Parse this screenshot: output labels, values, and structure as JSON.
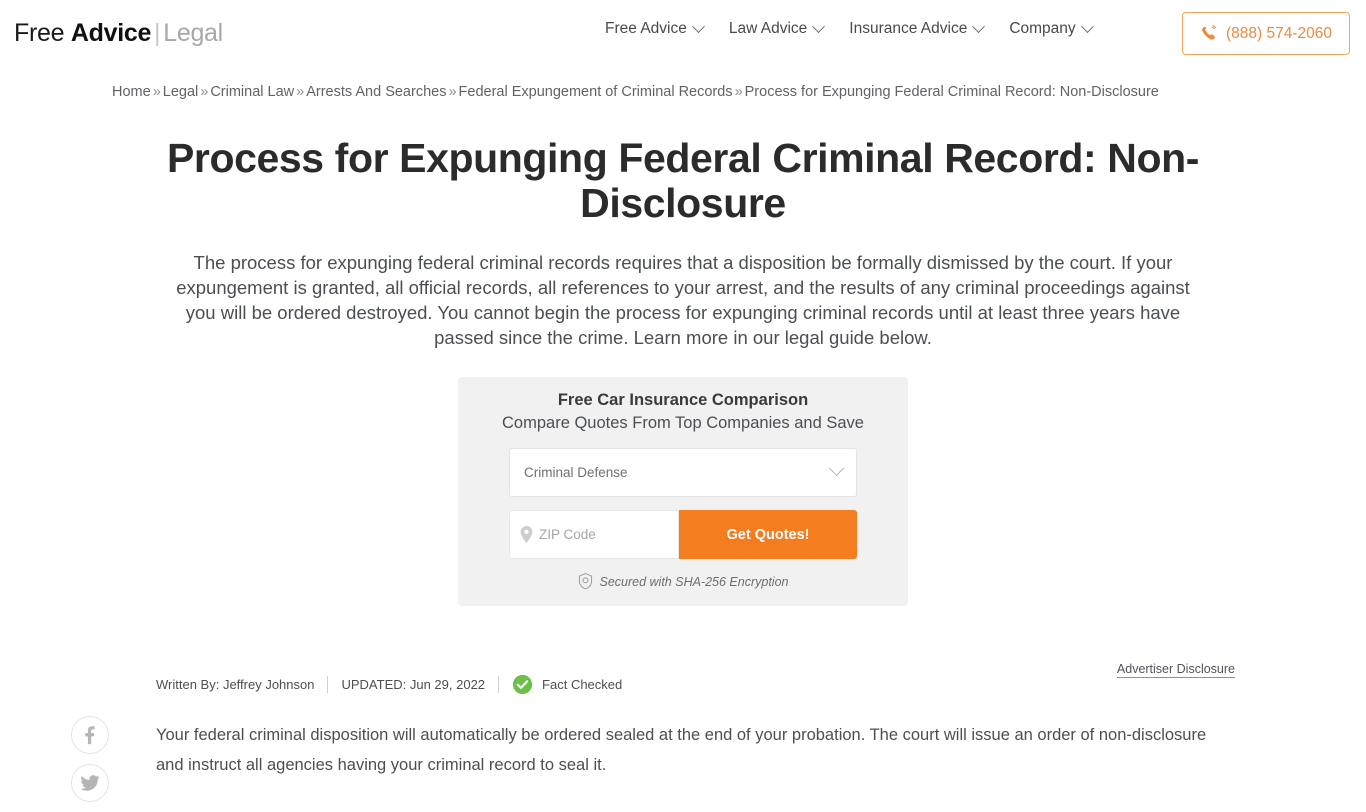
{
  "header": {
    "logo": {
      "part1": "Free ",
      "part2": "Advice",
      "divider": "|",
      "part3": "Legal"
    },
    "nav": [
      {
        "label": "Free Advice",
        "icon": "chevron-down-icon"
      },
      {
        "label": "Law Advice",
        "icon": "chevron-down-icon"
      },
      {
        "label": "Insurance Advice",
        "icon": "chevron-down-icon"
      },
      {
        "label": "Company",
        "icon": "chevron-down-icon"
      }
    ],
    "phone": {
      "number": "(888) 574-2060",
      "icon": "phone-icon",
      "color": "#e98b3e",
      "border_color": "#f0a35e"
    }
  },
  "breadcrumb": {
    "separator": "»",
    "items": [
      "Home",
      "Legal",
      "Criminal Law",
      "Arrests And Searches",
      "Federal Expungement of Criminal Records"
    ],
    "current": "Process for Expunging Federal Criminal Record: Non-Disclosure"
  },
  "article": {
    "title": "Process for Expunging Federal Criminal Record: Non-Disclosure",
    "lede": "The process for expunging federal criminal records requires that a disposition be formally dismissed by the court. If your expungement is granted, all official records, all references to your arrest, and the results of any criminal proceedings against you will be ordered destroyed. You cannot begin the process for expunging criminal records until at least three years have passed since the crime. Learn more in our legal guide below.",
    "body": "Your federal criminal disposition will automatically be ordered sealed at the end of your probation. The court will issue an order of non-disclosure and instruct all agencies having your criminal record to seal it."
  },
  "quote_form": {
    "title": "Free Car Insurance Comparison",
    "subtitle": "Compare Quotes From Top Companies and Save",
    "select": {
      "value": "Criminal Defense",
      "icon": "chevron-down-icon"
    },
    "zip": {
      "placeholder": "ZIP Code",
      "value": "",
      "icon": "map-pin-icon"
    },
    "submit_label": "Get Quotes!",
    "submit_color": "#f47d20",
    "secure_note": "Secured with SHA-256 Encryption",
    "secure_icon": "shield-check-icon",
    "background": "#f1f1f1"
  },
  "meta": {
    "advertiser_disclosure": "Advertiser Disclosure",
    "written_by": "Written By: Jeffrey Johnson",
    "updated": "UPDATED: Jun 29, 2022",
    "fact_checked": "Fact Checked",
    "fact_checked_color": "#6cc04a"
  },
  "social": [
    {
      "name": "facebook-share-button",
      "icon": "facebook-icon"
    },
    {
      "name": "twitter-share-button",
      "icon": "twitter-icon"
    }
  ]
}
